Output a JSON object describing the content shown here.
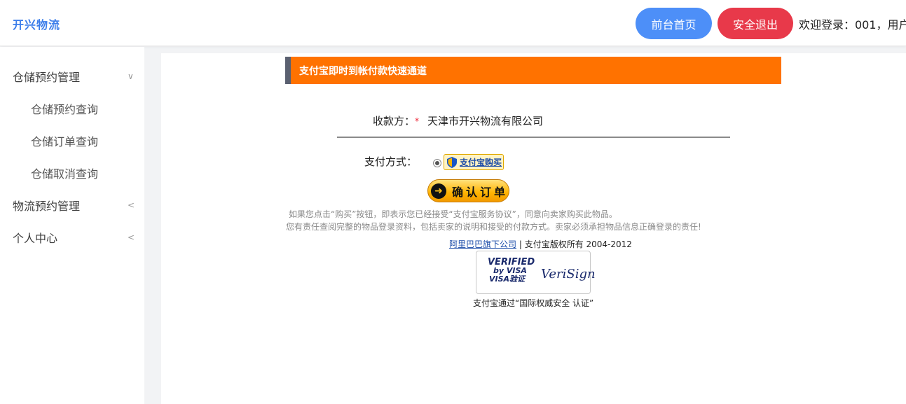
{
  "header": {
    "brand": "开兴物流",
    "home_button": "前台首页",
    "logout_button": "安全退出",
    "welcome": "欢迎登录：001，用户"
  },
  "sidebar": {
    "items": [
      {
        "label": "仓储预约管理",
        "level": 1,
        "arrow": "∨"
      },
      {
        "label": "仓储预约查询",
        "level": 2
      },
      {
        "label": "仓储订单查询",
        "level": 2
      },
      {
        "label": "仓储取消查询",
        "level": 2
      },
      {
        "label": "物流预约管理",
        "level": 1,
        "arrow": "<"
      },
      {
        "label": "个人中心",
        "level": 1,
        "arrow": "<"
      }
    ]
  },
  "payment": {
    "banner_title": "支付宝即时到帐付款快速通道",
    "payee_label": "收款方：",
    "required_mark": "*",
    "payee_value": "天津市开兴物流有限公司",
    "method_label": "支付方式：",
    "alipay_button": "支付宝购买",
    "confirm_button": "确认订单",
    "notice_line1": "如果您点击“购买”按钮，即表示您已经接受“支付宝服务协议”，同意向卖家购买此物品。",
    "notice_line2": "您有责任查阅完整的物品登录资料，包括卖家的说明和接受的付款方式。卖家必须承担物品信息正确登录的责任!",
    "alibaba_link": "阿里巴巴旗下公司",
    "copyright_text": " | 支付宝版权所有 2004-2012",
    "visa_line1": "VERIFIED",
    "visa_line2": "by VISA",
    "visa_line3": "VISA验证",
    "verisign": "VeriSign",
    "cert_caption": "支付宝通过“国际权威安全 认证”"
  },
  "colors": {
    "brand": "#3b7dea",
    "home_button": "#4d8ff8",
    "logout_button": "#e8394a",
    "banner": "#ff7200",
    "banner_border": "#5a6070"
  }
}
